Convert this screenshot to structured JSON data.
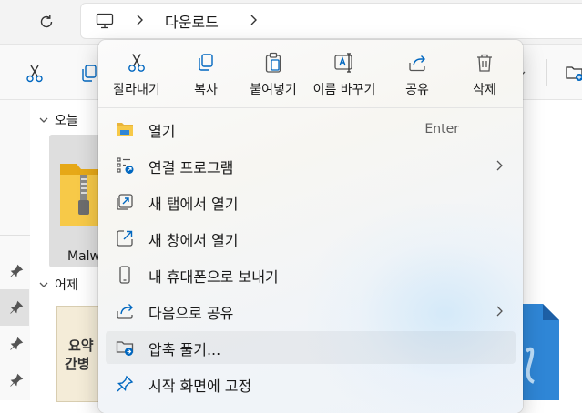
{
  "address_bar": {
    "breadcrumb": [
      "다운로드"
    ]
  },
  "content": {
    "groups": {
      "today": "오늘",
      "yesterday": "어제"
    },
    "selected_file_label": "Malw",
    "doc_thumb_lines": [
      "요약",
      "간병"
    ]
  },
  "context_menu": {
    "quick_actions": [
      {
        "label": "잘라내기",
        "icon": "cut-icon"
      },
      {
        "label": "복사",
        "icon": "copy-icon"
      },
      {
        "label": "붙여넣기",
        "icon": "paste-icon"
      },
      {
        "label": "이름 바꾸기",
        "icon": "rename-icon"
      },
      {
        "label": "공유",
        "icon": "share-icon"
      },
      {
        "label": "삭제",
        "icon": "delete-icon"
      }
    ],
    "items": [
      {
        "label": "열기",
        "shortcut": "Enter",
        "icon": "folder-open-icon",
        "submenu": false
      },
      {
        "label": "연결 프로그램",
        "icon": "open-with-icon",
        "submenu": true
      },
      {
        "label": "새 탭에서 열기",
        "icon": "new-tab-icon",
        "submenu": false
      },
      {
        "label": "새 창에서 열기",
        "icon": "new-window-icon",
        "submenu": false
      },
      {
        "label": "내 휴대폰으로 보내기",
        "icon": "phone-icon",
        "submenu": false
      },
      {
        "label": "다음으로 공유",
        "icon": "share-to-icon",
        "submenu": true
      },
      {
        "label": "압축 풀기...",
        "icon": "extract-icon",
        "submenu": false,
        "highlighted": true
      },
      {
        "label": "시작 화면에 고정",
        "icon": "pin-icon",
        "submenu": false
      }
    ]
  },
  "colors": {
    "accent": "#0067c0",
    "folder_yellow": "#f5c542",
    "menu_bg": "#f8f8f6"
  }
}
